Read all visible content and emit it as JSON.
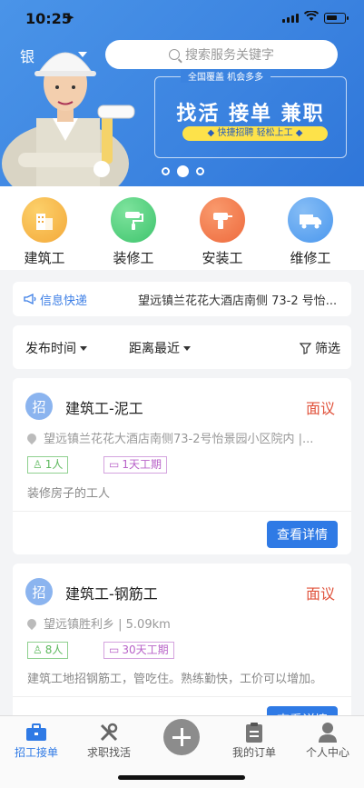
{
  "status": {
    "time": "10:25"
  },
  "banner": {
    "city": "银",
    "search_placeholder": "搜索服务关键字",
    "promo_sub": "全国覆盖 机会多多",
    "promo_main": "找活 接单 兼职",
    "promo_pill": "◆ 快捷招聘 轻松上工 ◆",
    "carousel_active_index": 1
  },
  "categories": [
    {
      "label": "建筑工",
      "color": "#f3a93a"
    },
    {
      "label": "装修工",
      "color": "#3ec46d"
    },
    {
      "label": "安装工",
      "color": "#ee6a3d"
    },
    {
      "label": "维修工",
      "color": "#4a97ee"
    }
  ],
  "info": {
    "tag": "信息快递",
    "text": "望远镇兰花花大酒店南侧 73-2 号怡..."
  },
  "filter": {
    "publish_time": "发布时间",
    "distance": "距离最近",
    "screen": "筛选"
  },
  "jobs": [
    {
      "avatar": "招",
      "title": "建筑工-泥工",
      "price": "面议",
      "address": "望远镇兰花花大酒店南侧73-2号怡景园小区院内 |...",
      "people": "1人",
      "duration": "1天工期",
      "desc": "装修房子的工人",
      "button": "查看详情"
    },
    {
      "avatar": "招",
      "title": "建筑工-钢筋工",
      "price": "面议",
      "address": "望远镇胜利乡 | 5.09km",
      "people": "8人",
      "duration": "30天工期",
      "desc": "建筑工地招钢筋工，管吃住。熟练勤快，工价可以增加。",
      "button": "查看详情"
    }
  ],
  "tabs": [
    {
      "label": "招工接单",
      "icon": "briefcase-icon",
      "active": true
    },
    {
      "label": "求职找活",
      "icon": "tools-icon",
      "active": false
    },
    {
      "label": "",
      "icon": "plus-icon",
      "active": false
    },
    {
      "label": "我的订单",
      "icon": "clipboard-icon",
      "active": false
    },
    {
      "label": "个人中心",
      "icon": "user-icon",
      "active": false
    }
  ]
}
